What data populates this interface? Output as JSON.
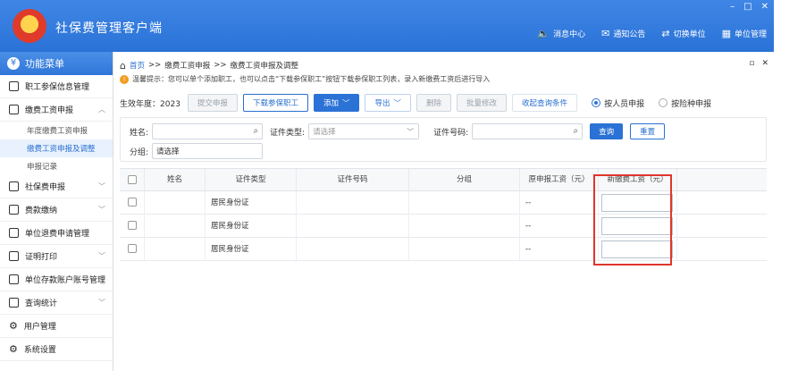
{
  "app": {
    "title": "社保费管理客户端",
    "window_controls": [
      "–",
      "□",
      "✕"
    ],
    "top_actions": [
      {
        "icon": "speaker-icon",
        "glyph": "🔈",
        "label": "消息中心"
      },
      {
        "icon": "mail-icon",
        "glyph": "✉",
        "label": "通知公告"
      },
      {
        "icon": "switch-icon",
        "glyph": "⇄",
        "label": "切换单位"
      },
      {
        "icon": "building-icon",
        "glyph": "▦",
        "label": "单位管理"
      }
    ]
  },
  "sidebar": {
    "header": "功能菜单",
    "items": [
      {
        "label": "职工参保信息管理",
        "icon": "▤"
      },
      {
        "label": "缴费工资申报",
        "icon": "✎",
        "expanded": true,
        "children": [
          {
            "label": "年度缴费工资申报",
            "active": false
          },
          {
            "label": "缴费工资申报及调整",
            "active": true
          },
          {
            "label": "申报记录",
            "active": false
          }
        ]
      },
      {
        "label": "社保费申报",
        "icon": "▥",
        "chevron": true
      },
      {
        "label": "费款缴纳",
        "icon": "▧",
        "chevron": true
      },
      {
        "label": "单位退费申请管理",
        "icon": "▤"
      },
      {
        "label": "证明打印",
        "icon": "▨",
        "chevron": true
      },
      {
        "label": "单位存款账户账号管理",
        "icon": "▧"
      },
      {
        "label": "查询统计",
        "icon": "▥",
        "chevron": true
      },
      {
        "label": "用户管理",
        "icon": "⚙"
      },
      {
        "label": "系统设置",
        "icon": "⚙"
      }
    ]
  },
  "main": {
    "breadcrumb": [
      "首页",
      ">>",
      "缴费工资申报",
      ">>",
      "缴费工资申报及调整"
    ],
    "tab_controls": [
      "▫",
      "✕"
    ],
    "tip": "温馨提示：您可以单个添加职工，也可以点击“下载参保职工”按钮下载参保职工列表，录入新缴费工资后进行导入",
    "toolbar": {
      "year_label": "生效年度：",
      "year_value": "2023",
      "submit": "提交申报",
      "download": "下载参保职工",
      "add": "添加",
      "export": "导出",
      "delete": "删除",
      "batch_edit": "批量修改",
      "collapse": "收起查询条件",
      "radio_person": "按人员申报",
      "radio_type": "按险种申报"
    },
    "filter": {
      "name_label": "姓名:",
      "id_type_label": "证件类型:",
      "id_type_placeholder": "请选择",
      "id_no_label": "证件号码:",
      "group_label": "分组:",
      "group_value": "请选择",
      "query": "查询",
      "reset": "重置"
    },
    "table": {
      "headers": [
        "姓名",
        "证件类型",
        "证件号码",
        "分组",
        "原申报工资（元）",
        "新缴费工资（元）"
      ],
      "rows": [
        {
          "id_type": "居民身份证",
          "old_wage": "--"
        },
        {
          "id_type": "居民身份证",
          "old_wage": "--"
        },
        {
          "id_type": "居民身份证",
          "old_wage": "--"
        }
      ]
    }
  },
  "colors": {
    "brand": "#2a72d6",
    "highlight_box": "#e0352b"
  }
}
